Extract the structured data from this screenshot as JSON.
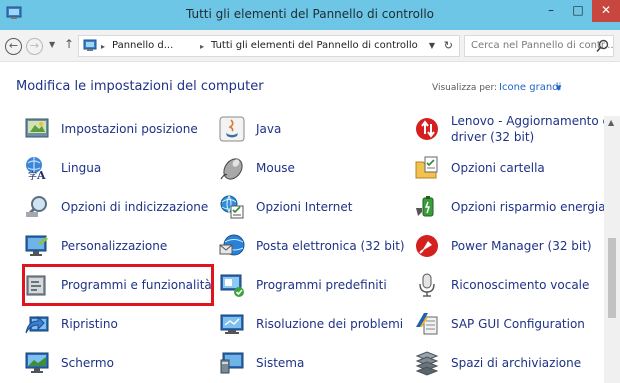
{
  "window": {
    "title": "Tutti gli elementi del Pannello di controllo",
    "buttons": {
      "minimize": "–",
      "maximize": "□",
      "close": "✕"
    },
    "accent": "#6ec6e6"
  },
  "address": {
    "breadcrumb": [
      "Pannello d...",
      "Tutti gli elementi del Pannello di controllo"
    ],
    "separator": "▸",
    "search_placeholder": "Cerca nel Pannello di contr..."
  },
  "content": {
    "heading": "Modifica le impostazioni del computer",
    "view_by_label": "Visualizza per:",
    "view_by_value": "Icone grandi",
    "items": [
      {
        "label": "Impostazioni posizione",
        "icon": "location-settings-icon"
      },
      {
        "label": "Java",
        "icon": "java-icon"
      },
      {
        "label": "Lenovo - Aggiornamento e driver (32 bit)",
        "icon": "lenovo-update-icon"
      },
      {
        "label": "Lingua",
        "icon": "language-icon"
      },
      {
        "label": "Mouse",
        "icon": "mouse-icon"
      },
      {
        "label": "Opzioni cartella",
        "icon": "folder-options-icon"
      },
      {
        "label": "Opzioni di indicizzazione",
        "icon": "indexing-icon"
      },
      {
        "label": "Opzioni Internet",
        "icon": "internet-options-icon"
      },
      {
        "label": "Opzioni risparmio energia",
        "icon": "power-options-icon"
      },
      {
        "label": "Personalizzazione",
        "icon": "personalization-icon"
      },
      {
        "label": "Posta elettronica (32 bit)",
        "icon": "mail-icon"
      },
      {
        "label": "Power Manager (32 bit)",
        "icon": "power-manager-icon"
      },
      {
        "label": "Programmi e funzionalità",
        "icon": "programs-features-icon"
      },
      {
        "label": "Programmi predefiniti",
        "icon": "default-programs-icon"
      },
      {
        "label": "Riconoscimento vocale",
        "icon": "microphone-icon"
      },
      {
        "label": "Ripristino",
        "icon": "recovery-icon"
      },
      {
        "label": "Risoluzione dei problemi",
        "icon": "troubleshooting-icon"
      },
      {
        "label": "SAP GUI Configuration",
        "icon": "sap-gui-icon"
      },
      {
        "label": "Schermo",
        "icon": "display-icon"
      },
      {
        "label": "Sistema",
        "icon": "system-icon"
      },
      {
        "label": "Spazi di archiviazione",
        "icon": "storage-spaces-icon"
      }
    ],
    "selected_item": "Programmi e funzionalità",
    "highlight_color": "#e0141e"
  }
}
